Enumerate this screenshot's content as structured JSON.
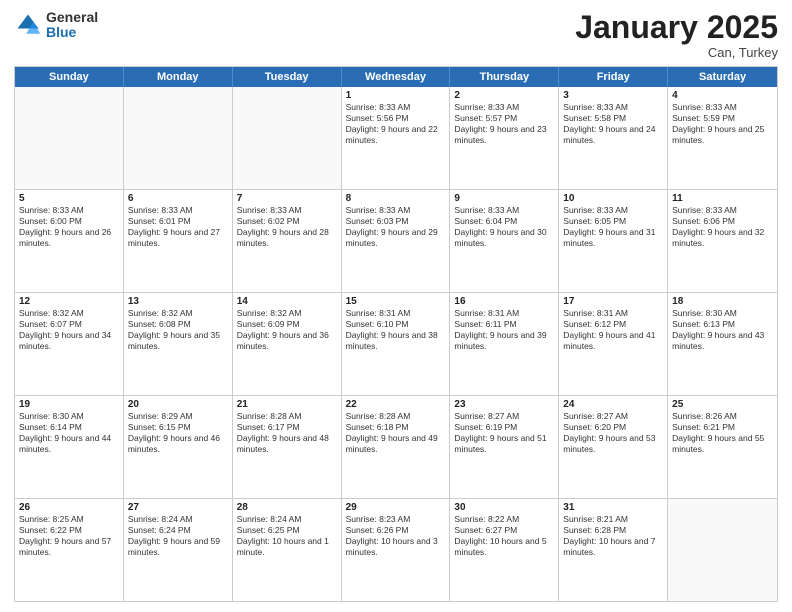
{
  "logo": {
    "general": "General",
    "blue": "Blue"
  },
  "title": "January 2025",
  "location": "Can, Turkey",
  "days": [
    "Sunday",
    "Monday",
    "Tuesday",
    "Wednesday",
    "Thursday",
    "Friday",
    "Saturday"
  ],
  "weeks": [
    [
      {
        "day": "",
        "text": ""
      },
      {
        "day": "",
        "text": ""
      },
      {
        "day": "",
        "text": ""
      },
      {
        "day": "1",
        "text": "Sunrise: 8:33 AM\nSunset: 5:56 PM\nDaylight: 9 hours and 22 minutes."
      },
      {
        "day": "2",
        "text": "Sunrise: 8:33 AM\nSunset: 5:57 PM\nDaylight: 9 hours and 23 minutes."
      },
      {
        "day": "3",
        "text": "Sunrise: 8:33 AM\nSunset: 5:58 PM\nDaylight: 9 hours and 24 minutes."
      },
      {
        "day": "4",
        "text": "Sunrise: 8:33 AM\nSunset: 5:59 PM\nDaylight: 9 hours and 25 minutes."
      }
    ],
    [
      {
        "day": "5",
        "text": "Sunrise: 8:33 AM\nSunset: 6:00 PM\nDaylight: 9 hours and 26 minutes."
      },
      {
        "day": "6",
        "text": "Sunrise: 8:33 AM\nSunset: 6:01 PM\nDaylight: 9 hours and 27 minutes."
      },
      {
        "day": "7",
        "text": "Sunrise: 8:33 AM\nSunset: 6:02 PM\nDaylight: 9 hours and 28 minutes."
      },
      {
        "day": "8",
        "text": "Sunrise: 8:33 AM\nSunset: 6:03 PM\nDaylight: 9 hours and 29 minutes."
      },
      {
        "day": "9",
        "text": "Sunrise: 8:33 AM\nSunset: 6:04 PM\nDaylight: 9 hours and 30 minutes."
      },
      {
        "day": "10",
        "text": "Sunrise: 8:33 AM\nSunset: 6:05 PM\nDaylight: 9 hours and 31 minutes."
      },
      {
        "day": "11",
        "text": "Sunrise: 8:33 AM\nSunset: 6:06 PM\nDaylight: 9 hours and 32 minutes."
      }
    ],
    [
      {
        "day": "12",
        "text": "Sunrise: 8:32 AM\nSunset: 6:07 PM\nDaylight: 9 hours and 34 minutes."
      },
      {
        "day": "13",
        "text": "Sunrise: 8:32 AM\nSunset: 6:08 PM\nDaylight: 9 hours and 35 minutes."
      },
      {
        "day": "14",
        "text": "Sunrise: 8:32 AM\nSunset: 6:09 PM\nDaylight: 9 hours and 36 minutes."
      },
      {
        "day": "15",
        "text": "Sunrise: 8:31 AM\nSunset: 6:10 PM\nDaylight: 9 hours and 38 minutes."
      },
      {
        "day": "16",
        "text": "Sunrise: 8:31 AM\nSunset: 6:11 PM\nDaylight: 9 hours and 39 minutes."
      },
      {
        "day": "17",
        "text": "Sunrise: 8:31 AM\nSunset: 6:12 PM\nDaylight: 9 hours and 41 minutes."
      },
      {
        "day": "18",
        "text": "Sunrise: 8:30 AM\nSunset: 6:13 PM\nDaylight: 9 hours and 43 minutes."
      }
    ],
    [
      {
        "day": "19",
        "text": "Sunrise: 8:30 AM\nSunset: 6:14 PM\nDaylight: 9 hours and 44 minutes."
      },
      {
        "day": "20",
        "text": "Sunrise: 8:29 AM\nSunset: 6:15 PM\nDaylight: 9 hours and 46 minutes."
      },
      {
        "day": "21",
        "text": "Sunrise: 8:28 AM\nSunset: 6:17 PM\nDaylight: 9 hours and 48 minutes."
      },
      {
        "day": "22",
        "text": "Sunrise: 8:28 AM\nSunset: 6:18 PM\nDaylight: 9 hours and 49 minutes."
      },
      {
        "day": "23",
        "text": "Sunrise: 8:27 AM\nSunset: 6:19 PM\nDaylight: 9 hours and 51 minutes."
      },
      {
        "day": "24",
        "text": "Sunrise: 8:27 AM\nSunset: 6:20 PM\nDaylight: 9 hours and 53 minutes."
      },
      {
        "day": "25",
        "text": "Sunrise: 8:26 AM\nSunset: 6:21 PM\nDaylight: 9 hours and 55 minutes."
      }
    ],
    [
      {
        "day": "26",
        "text": "Sunrise: 8:25 AM\nSunset: 6:22 PM\nDaylight: 9 hours and 57 minutes."
      },
      {
        "day": "27",
        "text": "Sunrise: 8:24 AM\nSunset: 6:24 PM\nDaylight: 9 hours and 59 minutes."
      },
      {
        "day": "28",
        "text": "Sunrise: 8:24 AM\nSunset: 6:25 PM\nDaylight: 10 hours and 1 minute."
      },
      {
        "day": "29",
        "text": "Sunrise: 8:23 AM\nSunset: 6:26 PM\nDaylight: 10 hours and 3 minutes."
      },
      {
        "day": "30",
        "text": "Sunrise: 8:22 AM\nSunset: 6:27 PM\nDaylight: 10 hours and 5 minutes."
      },
      {
        "day": "31",
        "text": "Sunrise: 8:21 AM\nSunset: 6:28 PM\nDaylight: 10 hours and 7 minutes."
      },
      {
        "day": "",
        "text": ""
      }
    ]
  ]
}
